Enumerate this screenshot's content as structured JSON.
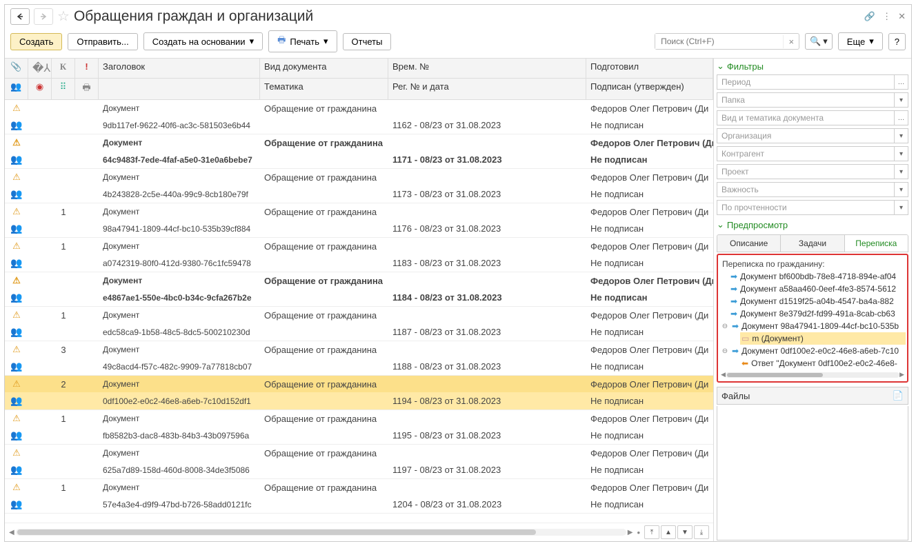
{
  "title": "Обращения граждан и организаций",
  "toolbar": {
    "create": "Создать",
    "send": "Отправить...",
    "create_based": "Создать на основании",
    "print": "Печать",
    "reports": "Отчеты",
    "more": "Еще",
    "search_placeholder": "Поиск (Ctrl+F)"
  },
  "columns": {
    "r1": {
      "title": "Заголовок",
      "doctype": "Вид документа",
      "num": "Врем. №",
      "who": "Подготовил"
    },
    "r2": {
      "title": "",
      "doctype": "Тематика",
      "num": "Рег. № и дата",
      "who": "Подписан (утвержден)"
    },
    "icon_k": "К",
    "icon_excl": "!"
  },
  "rows": [
    {
      "bold": false,
      "n": "",
      "t1": "Документ",
      "t2": "9db117ef-9622-40f6-ac3c-581503e6b44",
      "doc": "Обращение от гражданина",
      "num": "1162 - 08/23 от 31.08.2023",
      "who1": "Федоров Олег Петрович (Ди",
      "who2": "Не подписан"
    },
    {
      "bold": true,
      "n": "",
      "t1": "Документ",
      "t2": "64c9483f-7ede-4faf-a5e0-31e0a6bebe7",
      "doc": "Обращение от гражданина",
      "num": "1171 - 08/23 от 31.08.2023",
      "who1": "Федоров Олег Петрович (Ди",
      "who2": "Не подписан"
    },
    {
      "bold": false,
      "n": "",
      "t1": "Документ",
      "t2": "4b243828-2c5e-440a-99c9-8cb180e79f",
      "doc": "Обращение от гражданина",
      "num": "1173 - 08/23 от 31.08.2023",
      "who1": "Федоров Олег Петрович (Ди",
      "who2": "Не подписан"
    },
    {
      "bold": false,
      "n": "1",
      "t1": "Документ",
      "t2": "98a47941-1809-44cf-bc10-535b39cf884",
      "doc": "Обращение от гражданина",
      "num": "1176 - 08/23 от 31.08.2023",
      "who1": "Федоров Олег Петрович (Ди",
      "who2": "Не подписан"
    },
    {
      "bold": false,
      "n": "1",
      "t1": "Документ",
      "t2": "a0742319-80f0-412d-9380-76c1fc59478",
      "doc": "Обращение от гражданина",
      "num": "1183 - 08/23 от 31.08.2023",
      "who1": "Федоров Олег Петрович (Ди",
      "who2": "Не подписан"
    },
    {
      "bold": true,
      "n": "",
      "t1": "Документ",
      "t2": "e4867ae1-550e-4bc0-b34c-9cfa267b2e",
      "doc": "Обращение от гражданина",
      "num": "1184 - 08/23 от 31.08.2023",
      "who1": "Федоров Олег Петрович (Ди",
      "who2": "Не подписан"
    },
    {
      "bold": false,
      "n": "1",
      "t1": "Документ",
      "t2": "edc58ca9-1b58-48c5-8dc5-500210230d",
      "doc": "Обращение от гражданина",
      "num": "1187 - 08/23 от 31.08.2023",
      "who1": "Федоров Олег Петрович (Ди",
      "who2": "Не подписан"
    },
    {
      "bold": false,
      "n": "3",
      "t1": "Документ",
      "t2": "49c8acd4-f57c-482c-9909-7a77818cb07",
      "doc": "Обращение от гражданина",
      "num": "1188 - 08/23 от 31.08.2023",
      "who1": "Федоров Олег Петрович (Ди",
      "who2": "Не подписан"
    },
    {
      "bold": false,
      "n": "2",
      "t1": "Документ",
      "t2": "0df100e2-e0c2-46e8-a6eb-7c10d152df1",
      "doc": "Обращение от гражданина",
      "num": "1194 - 08/23 от 31.08.2023",
      "who1": "Федоров Олег Петрович (Ди",
      "who2": "Не подписан",
      "selected": true
    },
    {
      "bold": false,
      "n": "1",
      "t1": "Документ",
      "t2": "fb8582b3-dac8-483b-84b3-43b097596a",
      "doc": "Обращение от гражданина",
      "num": "1195 - 08/23 от 31.08.2023",
      "who1": "Федоров Олег Петрович (Ди",
      "who2": "Не подписан"
    },
    {
      "bold": false,
      "n": "",
      "t1": "Документ",
      "t2": "625a7d89-158d-460d-8008-34de3f5086",
      "doc": "Обращение от гражданина",
      "num": "1197 - 08/23 от 31.08.2023",
      "who1": "Федоров Олег Петрович (Ди",
      "who2": "Не подписан"
    },
    {
      "bold": false,
      "n": "1",
      "t1": "Документ",
      "t2": "57e4a3e4-d9f9-47bd-b726-58add0121fc",
      "doc": "Обращение от гражданина",
      "num": "1204 - 08/23 от 31.08.2023",
      "who1": "Федоров Олег Петрович (Ди",
      "who2": "Не подписан"
    }
  ],
  "filters": {
    "header": "Фильтры",
    "period": "Период",
    "folder": "Папка",
    "doctype": "Вид и тематика документа",
    "org": "Организация",
    "counterparty": "Контрагент",
    "project": "Проект",
    "importance": "Важность",
    "read": "По прочтенности"
  },
  "preview": {
    "header": "Предпросмотр",
    "tabs": {
      "desc": "Описание",
      "tasks": "Задачи",
      "thread": "Переписка"
    },
    "title": "Переписка по гражданину:",
    "items": [
      {
        "indent": 1,
        "type": "in",
        "text": "Документ bf600bdb-78e8-4718-894e-af04"
      },
      {
        "indent": 1,
        "type": "in",
        "text": "Документ a58aa460-0eef-4fe3-8574-5612"
      },
      {
        "indent": 1,
        "type": "in",
        "text": "Документ d1519f25-a04b-4547-ba4a-882"
      },
      {
        "indent": 1,
        "type": "in",
        "text": "Документ 8e379d2f-fd99-491a-8cab-cb63"
      },
      {
        "indent": 0,
        "type": "in",
        "text": "Документ 98a47941-1809-44cf-bc10-535b",
        "expander": "⊖"
      },
      {
        "indent": 2,
        "type": "doc",
        "text": "m (Документ)",
        "selected": true
      },
      {
        "indent": 0,
        "type": "in",
        "text": "Документ 0df100e2-e0c2-46e8-a6eb-7c10",
        "expander": "⊖"
      },
      {
        "indent": 2,
        "type": "out",
        "text": "Ответ \"Документ 0df100e2-e0c2-46e8-"
      }
    ]
  },
  "files_header": "Файлы"
}
